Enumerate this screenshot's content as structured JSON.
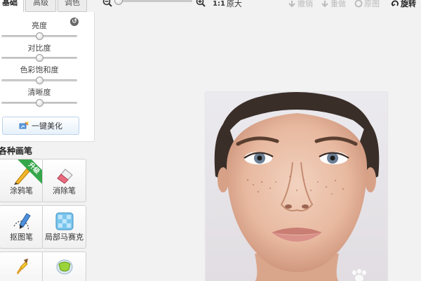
{
  "tabs": [
    {
      "label": "基础",
      "active": true
    },
    {
      "label": "高级",
      "active": false
    },
    {
      "label": "调色",
      "active": false
    }
  ],
  "adjust": {
    "reset_icon": "reset-icon",
    "sliders": [
      {
        "label": "亮度",
        "value": 0.5
      },
      {
        "label": "对比度",
        "value": 0.5
      },
      {
        "label": "色彩饱和度",
        "value": 0.5
      },
      {
        "label": "清晰度",
        "value": 0.5
      }
    ],
    "beautify_label": "一键美化"
  },
  "brushes": {
    "title": "各种画笔",
    "tools": [
      {
        "label": "涂鸦笔",
        "icon": "doodle-pen-icon",
        "badge": "升级"
      },
      {
        "label": "消除笔",
        "icon": "eraser-icon"
      },
      {
        "label": "抠图笔",
        "icon": "cutout-pen-icon"
      },
      {
        "label": "局部马赛克",
        "icon": "mosaic-icon"
      },
      {
        "label": "",
        "icon": "paint-brush-icon"
      },
      {
        "label": "",
        "icon": "paint-bucket-icon"
      }
    ]
  },
  "toolbar": {
    "zoom_level": 0.0,
    "original_size_prefix": "1:1",
    "original_size_label": "原大",
    "undo_label": "撤销",
    "redo_label": "重做",
    "original_label": "原图",
    "rotate_label": "旋转"
  },
  "colors": {
    "accent": "#35a64a",
    "panel_bg": "#ffffff",
    "canvas_bg": "#f2f2f2",
    "button_border": "#bcd3ea"
  }
}
